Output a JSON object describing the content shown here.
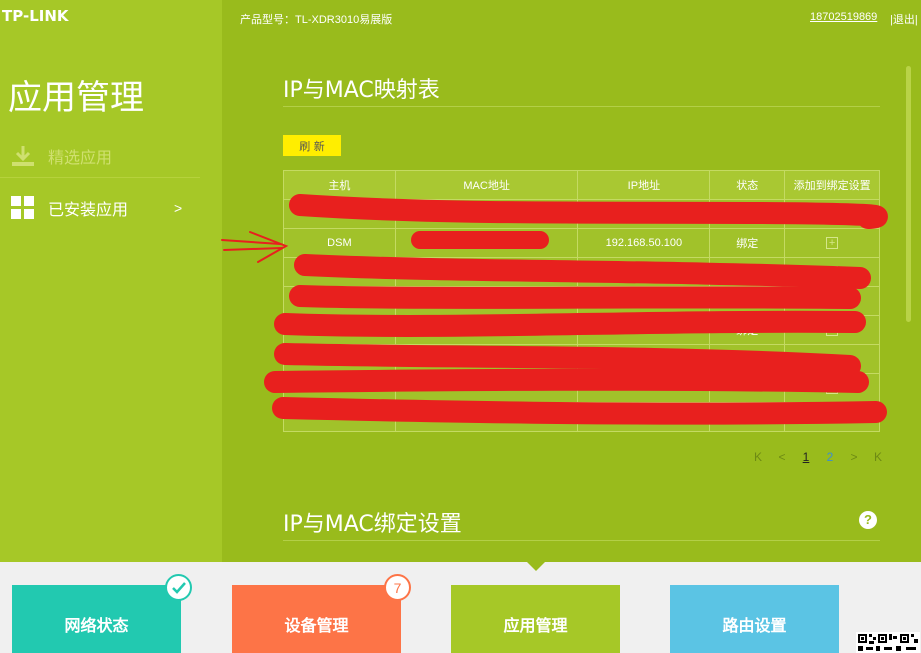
{
  "brand": {
    "logo": "TP-LINK"
  },
  "header": {
    "model": "产品型号：TL-XDR3010易展版",
    "user": "18702519869",
    "logout": "|退出|"
  },
  "sidebar": {
    "title": "应用管理",
    "items": [
      {
        "label": "精选应用",
        "icon": "download-icon"
      },
      {
        "label": "已安装应用",
        "icon": "grid-icon"
      }
    ],
    "chevron": ">"
  },
  "section1": {
    "title": "IP与MAC映射表",
    "refresh_label": "刷 新",
    "columns": [
      "主机",
      "MAC地址",
      "IP地址",
      "状态",
      "添加到绑定设置"
    ],
    "rows": [
      {
        "host": "",
        "mac": "",
        "ip": "",
        "status": "",
        "add": ""
      },
      {
        "host": "DSM",
        "mac": "",
        "ip": "192.168.50.100",
        "status": "绑定",
        "add": "+"
      },
      {
        "host": "",
        "mac": "",
        "ip": "",
        "status": "",
        "add": "+"
      },
      {
        "host": "",
        "mac": "",
        "ip": "",
        "status": "",
        "add": "+"
      },
      {
        "host": "",
        "mac": "",
        "ip": "",
        "status": "绑定",
        "add": "+"
      },
      {
        "host": "",
        "mac": "",
        "ip": "",
        "status": "",
        "add": ""
      },
      {
        "host": "",
        "mac": "",
        "ip": "",
        "status": "",
        "add": "+"
      },
      {
        "host": "",
        "mac": "",
        "ip": "",
        "status": "",
        "add": ""
      }
    ],
    "pager": {
      "first": "K",
      "prev": "<",
      "pages": [
        "1",
        "2"
      ],
      "current": "1",
      "next": ">",
      "last": "K"
    }
  },
  "section2": {
    "title": "IP与MAC绑定设置",
    "help": "?"
  },
  "tiles": [
    {
      "label": "网络状态",
      "color": "#22c9b0"
    },
    {
      "label": "设备管理",
      "color": "#fd7447",
      "badge": "7"
    },
    {
      "label": "应用管理",
      "color": "#a6c827"
    },
    {
      "label": "路由设置",
      "color": "#5bc4e4"
    }
  ],
  "colors": {
    "main_bg": "#99bb1c",
    "sidebar_bg": "#a6c827",
    "refresh_bg": "#ffee00",
    "scribble": "#e8201e"
  }
}
